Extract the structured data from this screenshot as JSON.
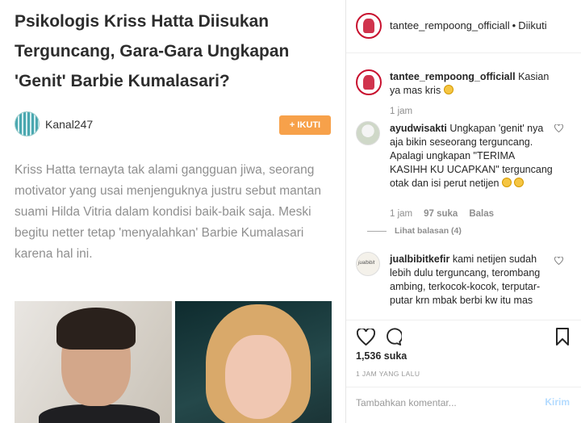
{
  "article": {
    "title": "Psikologis Kriss Hatta Diisukan Terguncang, Gara-Gara Ungkapan 'Genit' Barbie Kumalasari?",
    "author": "Kanal247",
    "follow_label": "+ IKUTI",
    "body": "Kriss Hatta ternayta tak alami gangguan jiwa, seorang motivator yang usai menjenguknya justru sebut mantan suami Hilda Vitria dalam kondisi baik-baik saja. Meski begitu netter tetap 'menyalahkan' Barbie Kumalasari karena hal ini."
  },
  "instagram": {
    "header": {
      "username": "tantee_rempoong_officiall",
      "separator": "•",
      "follow_status": "Diikuti"
    },
    "comments": [
      {
        "username": "tantee_rempoong_officiall",
        "text": "Kasian ya mas kris",
        "meta": [
          "1 jam"
        ]
      },
      {
        "username": "ayudwisakti",
        "text": "Ungkapan 'genit' nya aja bikin seseorang terguncang. Apalagi ungkapan \"TERIMA KASIHH KU UCAPKAN\" terguncang otak dan isi perut netijen",
        "meta": [
          "1 jam",
          "97 suka",
          "Balas"
        ],
        "view_replies": "Lihat balasan (4)"
      },
      {
        "username": "jualbibitkefir",
        "text": "kami netijen sudah lebih dulu terguncang, terombang ambing, terkocok-kocok, terputar-putar krn mbak berbi kw itu mas"
      }
    ],
    "likes": "1,536 suka",
    "time_ago": "1 JAM YANG LALU",
    "comment_placeholder": "Tambahkan komentar...",
    "post_label": "Kirim"
  },
  "colors": {
    "follow_button": "#f7a14a",
    "avatar_ring": "#c8102e",
    "post_button_disabled": "#b3dbff"
  },
  "icons": [
    "heart-icon",
    "comment-icon",
    "bookmark-icon"
  ]
}
